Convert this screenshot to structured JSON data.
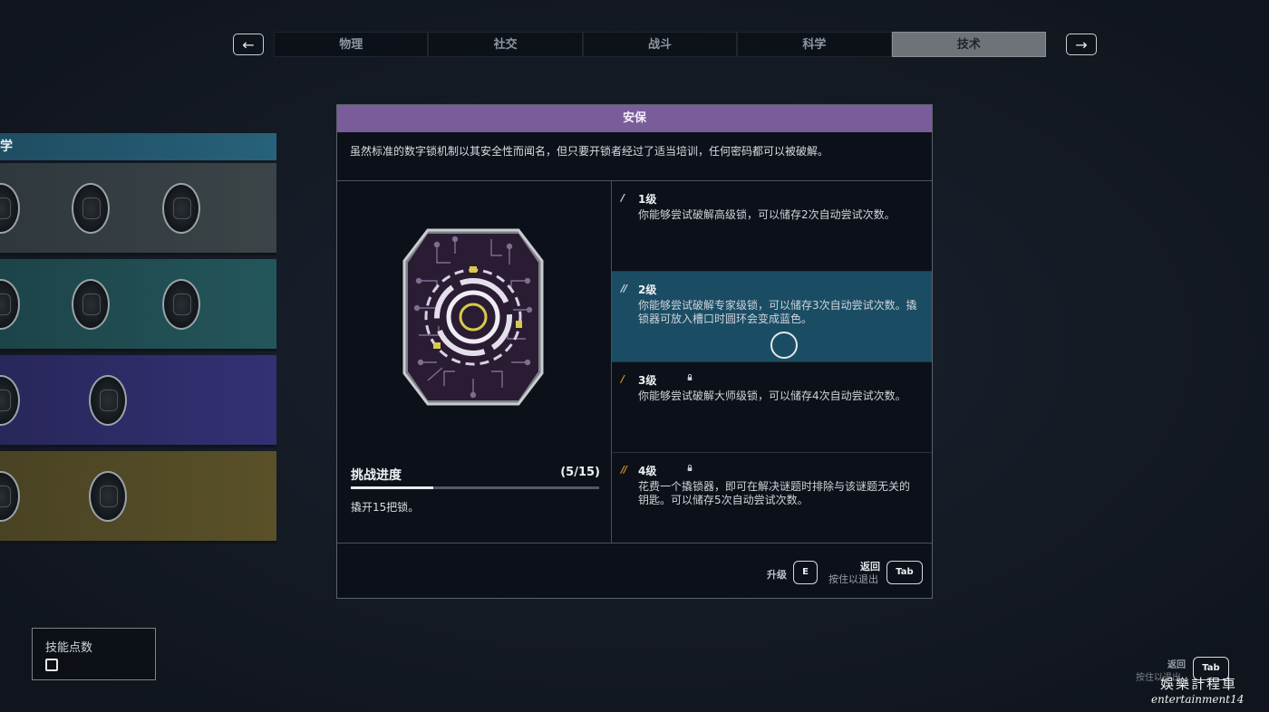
{
  "nav": {
    "prev_arrow": "←",
    "next_arrow": "→",
    "tabs": [
      {
        "label": "物理",
        "active": false
      },
      {
        "label": "社交",
        "active": false
      },
      {
        "label": "战斗",
        "active": false
      },
      {
        "label": "科学",
        "active": false
      },
      {
        "label": "技术",
        "active": true
      }
    ]
  },
  "skill_tree": {
    "header": "学",
    "rows": [
      {
        "color": "#3b4548",
        "nodes": 3
      },
      {
        "color": "#23565b",
        "nodes": 3
      },
      {
        "color": "#333174",
        "nodes": 2
      },
      {
        "color": "#5a5129",
        "nodes": 2
      }
    ]
  },
  "skill_points": {
    "label": "技能点数",
    "value": "0"
  },
  "dialog": {
    "title": "安保",
    "title_color": "#7a5c9b",
    "description": "虽然标准的数字锁机制以其安全性而闻名，但只要开锁者经过了适当培训，任何密码都可以被破解。",
    "badge_icon": "circuit-lock-badge-icon",
    "challenge": {
      "title": "挑战进度",
      "count": "(5/15)",
      "progress": 0.333,
      "description": "撬开15把锁。"
    },
    "levels": [
      {
        "ticks": "/",
        "tick_color": "#d7dbe0",
        "name": "1级",
        "locked": false,
        "selected": false,
        "desc": "你能够尝试破解高级锁，可以储存2次自动尝试次数。"
      },
      {
        "ticks": "//",
        "tick_color": "#d7dbe0",
        "name": "2级",
        "locked": false,
        "selected": true,
        "desc": "你能够尝试破解专家级锁，可以储存3次自动尝试次数。撬锁器可放入槽口时圆环会变成蓝色。"
      },
      {
        "ticks": "/",
        "tick_color": "#e0902c",
        "name": "3级",
        "locked": true,
        "selected": false,
        "desc": "你能够尝试破解大师级锁，可以储存4次自动尝试次数。"
      },
      {
        "ticks": "//",
        "tick_color": "#e0902c",
        "name": "4级",
        "locked": true,
        "selected": false,
        "desc": "花费一个撬锁器，即可在解决谜题时排除与该谜题无关的钥匙。可以储存5次自动尝试次数。"
      }
    ],
    "footer": {
      "upgrade_label": "升级",
      "upgrade_key": "E",
      "back_label": "返回",
      "hold_exit_label": "按住以退出",
      "back_key": "Tab"
    }
  },
  "bottom_right": {
    "back_label": "返回",
    "hold_exit_label": "按住以退出",
    "key": "Tab"
  },
  "watermark": {
    "cn": "娛樂計程車",
    "en": "entertainment14"
  }
}
